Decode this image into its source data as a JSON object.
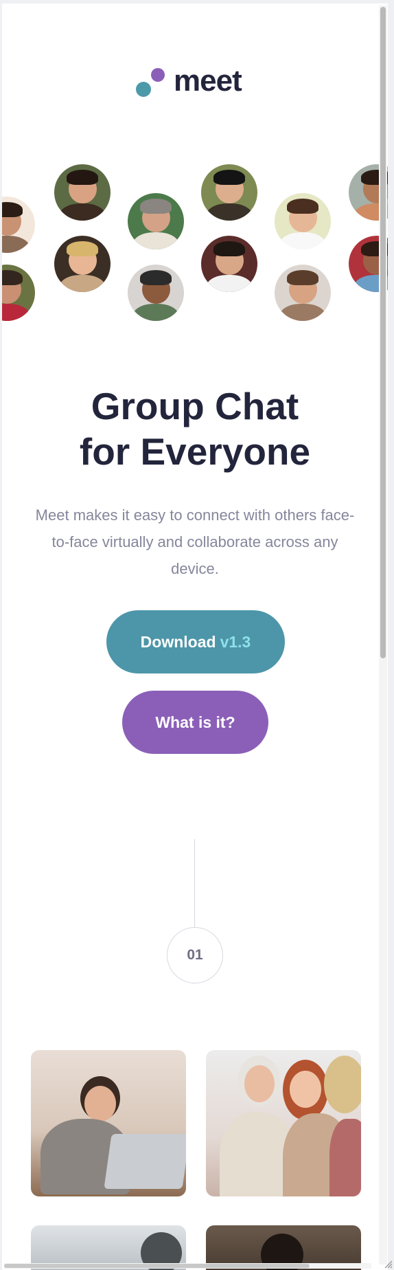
{
  "logo": {
    "text": "meet"
  },
  "avatars": [
    {
      "name": "avatar-person-1",
      "skin": "#c89273",
      "hair": "#2b1d16",
      "shirt": "#8a6b55",
      "bg": "#f3e7dc"
    },
    {
      "name": "avatar-person-2",
      "skin": "#d9a283",
      "hair": "#241712",
      "shirt": "#3c2b21",
      "bg": "#5c6b44"
    },
    {
      "name": "avatar-person-3",
      "skin": "#c99073",
      "hair": "#33261e",
      "shirt": "#b9283a",
      "bg": "#6a7342"
    },
    {
      "name": "avatar-person-4",
      "skin": "#e8b694",
      "hair": "#d8b56d",
      "shirt": "#c8a785",
      "bg": "#3b2e24"
    },
    {
      "name": "avatar-person-5",
      "skin": "#d4a286",
      "hair": "#8a8580",
      "shirt": "#e9e3d8",
      "bg": "#4c7a4a"
    },
    {
      "name": "avatar-person-6",
      "skin": "#8c5a3c",
      "hair": "#2b2b2b",
      "shirt": "#5d7a58",
      "bg": "#d8d4d2"
    },
    {
      "name": "avatar-person-7",
      "skin": "#dcae8e",
      "hair": "#141414",
      "shirt": "#3a3128",
      "bg": "#7d8a52"
    },
    {
      "name": "avatar-person-8",
      "skin": "#d8a787",
      "hair": "#1f1712",
      "shirt": "#f2f2f2",
      "bg": "#5a2c2a"
    },
    {
      "name": "avatar-person-9",
      "skin": "#e6b797",
      "hair": "#4a2f20",
      "shirt": "#f8f8f8",
      "bg": "#e6e7c4"
    },
    {
      "name": "avatar-person-10",
      "skin": "#d7a383",
      "hair": "#5a3e2b",
      "shirt": "#9b7a63",
      "bg": "#dcd5cf"
    },
    {
      "name": "avatar-person-11",
      "skin": "#b27a57",
      "hair": "#2a1b14",
      "shirt": "#d08b62",
      "bg": "#a5b0a9"
    },
    {
      "name": "avatar-person-12",
      "skin": "#9b6147",
      "hair": "#2e1b13",
      "shirt": "#6b9ec7",
      "bg": "#b0333b"
    }
  ],
  "hero": {
    "title_line1": "Group Chat",
    "title_line2": "for Everyone",
    "description": "Meet makes it easy to connect with others face-to-face virtually and collaborate across any device."
  },
  "buttons": {
    "download_label": "Download",
    "download_version": "v1.3",
    "what_label": "What is it?"
  },
  "step": {
    "number": "01"
  },
  "colors": {
    "teal": "#4d96a9",
    "purple": "#8b5fb8",
    "heading": "#23253c",
    "body_text": "#85869b"
  },
  "photos": [
    {
      "name": "photo-woman-laptop"
    },
    {
      "name": "photo-women-phone"
    },
    {
      "name": "photo-person-laptop"
    },
    {
      "name": "photo-man-shelves"
    }
  ]
}
